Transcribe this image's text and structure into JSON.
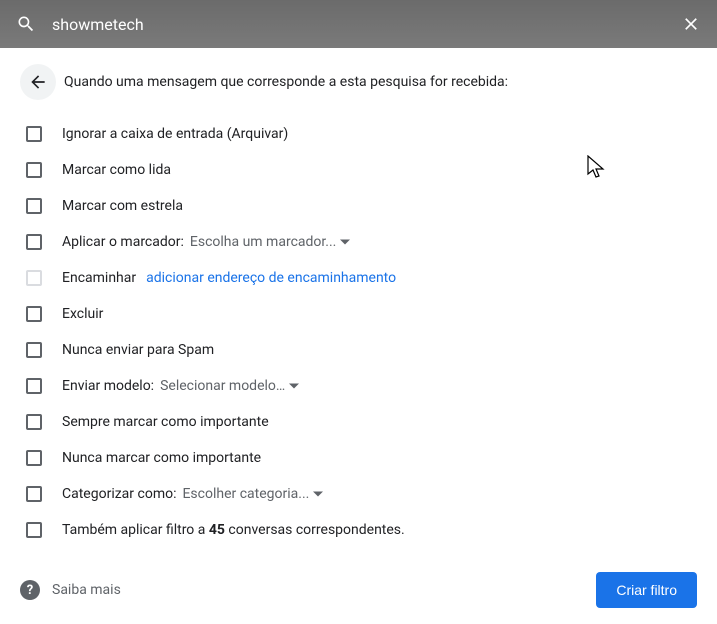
{
  "search": {
    "query": "showmetech"
  },
  "header": {
    "text": "Quando uma mensagem que corresponde a esta pesquisa for recebida:"
  },
  "options": {
    "archive": "Ignorar a caixa de entrada (Arquivar)",
    "mark_read": "Marcar como lida",
    "star": "Marcar com estrela",
    "apply_label": "Aplicar o marcador:",
    "apply_label_dropdown": "Escolha um marcador...",
    "forward": "Encaminhar",
    "forward_link": "adicionar endereço de encaminhamento",
    "delete": "Excluir",
    "never_spam": "Nunca enviar para Spam",
    "send_template": "Enviar modelo:",
    "send_template_dropdown": "Selecionar modelo…",
    "always_important": "Sempre marcar como importante",
    "never_important": "Nunca marcar como importante",
    "categorize": "Categorizar como:",
    "categorize_dropdown": "Escolher categoria...",
    "also_apply_prefix": "Também aplicar filtro a ",
    "also_apply_count": "45",
    "also_apply_suffix": " conversas correspondentes."
  },
  "footer": {
    "learn_more": "Saiba mais",
    "create_button": "Criar filtro"
  }
}
